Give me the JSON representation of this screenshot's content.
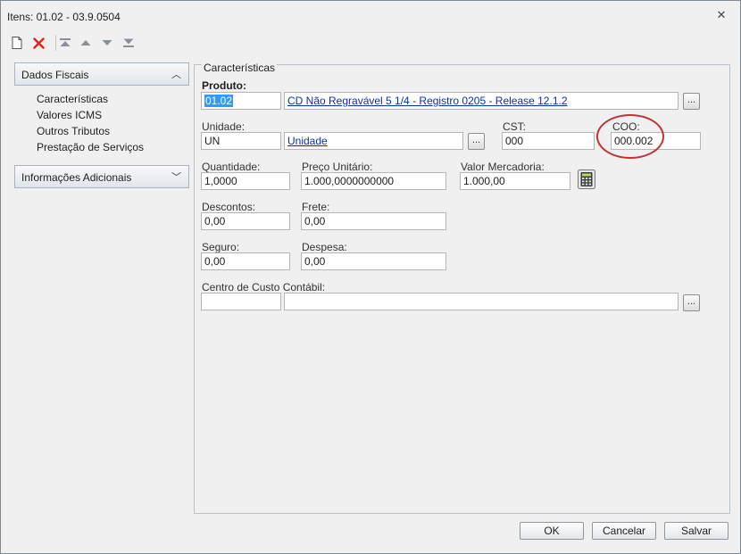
{
  "window": {
    "title": "Itens: 01.02 - 03.9.0504",
    "close_icon": "close-icon"
  },
  "toolbar": {
    "icons": [
      "new-document-icon",
      "delete-icon",
      "first-record-icon",
      "previous-record-icon",
      "next-record-icon",
      "last-record-icon"
    ]
  },
  "sidebar": {
    "groups": [
      {
        "label": "Dados Fiscais",
        "expanded": true,
        "items": [
          "Características",
          "Valores ICMS",
          "Outros Tributos",
          "Prestação de Serviços"
        ]
      },
      {
        "label": "Informações Adicionais",
        "expanded": false,
        "items": []
      }
    ]
  },
  "form": {
    "section_title": "Características",
    "produto": {
      "label": "Produto:",
      "code": "01.02",
      "description": "CD Não Regravável 5 1/4 - Registro 0205 - Release 12.1.2",
      "lookup_label": "..."
    },
    "unidade": {
      "label": "Unidade:",
      "code": "UN",
      "description": "Unidade",
      "lookup_label": "..."
    },
    "cst": {
      "label": "CST:",
      "value": "000"
    },
    "coo": {
      "label": "COO:",
      "value": "000.002"
    },
    "quantidade": {
      "label": "Quantidade:",
      "value": "1,0000"
    },
    "preco_unitario": {
      "label": "Preço Unitário:",
      "value": "1.000,0000000000"
    },
    "valor_mercadoria": {
      "label": "Valor Mercadoria:",
      "value": "1.000,00"
    },
    "descontos": {
      "label": "Descontos:",
      "value": "0,00"
    },
    "frete": {
      "label": "Frete:",
      "value": "0,00"
    },
    "seguro": {
      "label": "Seguro:",
      "value": "0,00"
    },
    "despesa": {
      "label": "Despesa:",
      "value": "0,00"
    },
    "centro_custo": {
      "label": "Centro de Custo Contábil:",
      "code": "",
      "description": "",
      "lookup_label": "..."
    }
  },
  "footer": {
    "ok_label": "OK",
    "cancel_label": "Cancelar",
    "save_label": "Salvar"
  },
  "colors": {
    "link": "#0a2fae",
    "selection": "#3399ff",
    "highlight_circle": "#c03434",
    "delete_icon": "#e02020"
  }
}
